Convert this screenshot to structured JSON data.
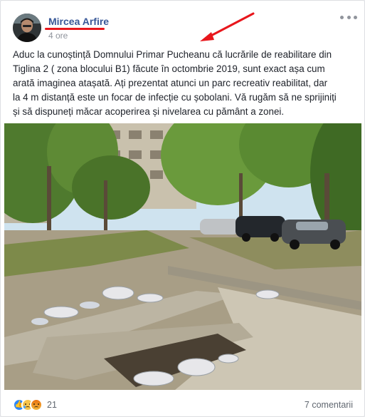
{
  "post": {
    "author": "Mircea Arfire",
    "timestamp": "4 ore",
    "text": "Aduc la cunoștință Domnului Primar Pucheanu că lucrările de reabilitare din\nTiglina 2 ( zona blocului B1) făcute în octombrie 2019, sunt exact așa cum\narată imaginea atașată. Ați prezentat atunci un parc recreativ reabilitat, dar\nla 4 m distanță este un focar de infecție cu șobolani. Vă rugăm să ne sprijiniți\nși să dispuneți măcar acoperirea și nivelarea cu pământ a zonei."
  },
  "footer": {
    "reactions": [
      "like-icon",
      "sad-icon",
      "angry-icon"
    ],
    "reaction_count": "21",
    "comments": "7 comentarii"
  },
  "annotations": {
    "underline_color": "#e8161c",
    "arrow_color": "#e8161c"
  },
  "colors": {
    "author_link": "#385898",
    "meta_text": "#90949c",
    "body_text": "#1d2129"
  }
}
